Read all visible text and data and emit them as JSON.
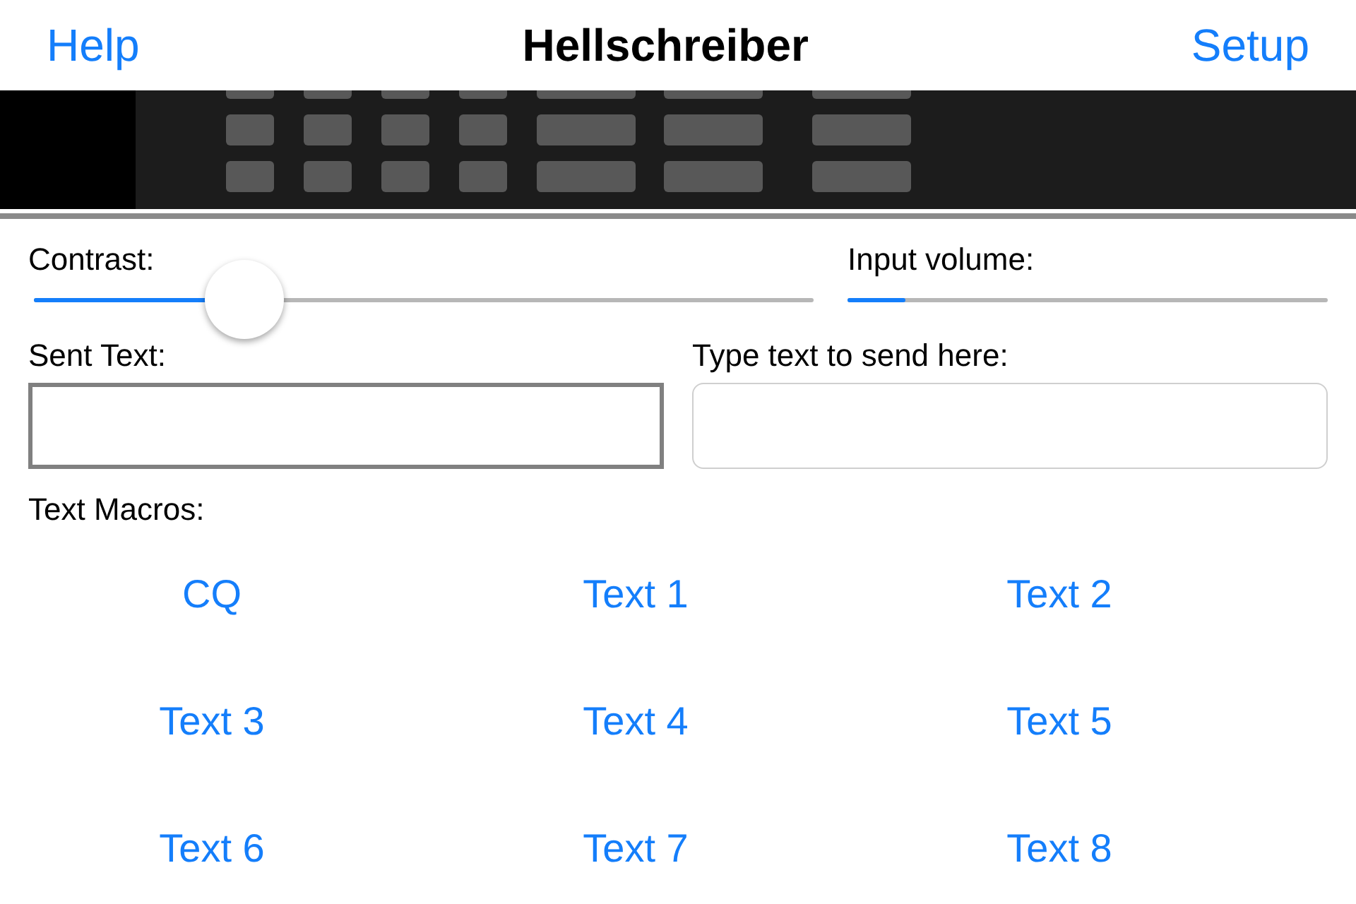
{
  "nav": {
    "left": "Help",
    "title": "Hellschreiber",
    "right": "Setup"
  },
  "contrast": {
    "label": "Contrast:",
    "level": 0.27
  },
  "input_volume": {
    "label": "Input volume:",
    "level": 0.12
  },
  "sent_text": {
    "label": "Sent Text:"
  },
  "send_field": {
    "label": "Type text to send here:"
  },
  "macros": {
    "label": "Text Macros:",
    "buttons": [
      "CQ",
      "Text 1",
      "Text 2",
      "Text 3",
      "Text 4",
      "Text 5",
      "Text 6",
      "Text 7",
      "Text 8"
    ]
  }
}
